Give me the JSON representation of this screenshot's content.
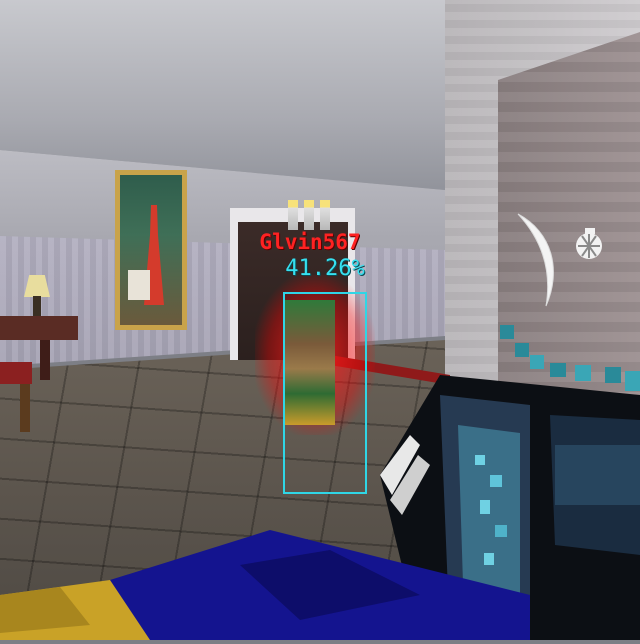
{
  "enemy": {
    "player_name": "Glvin567",
    "detection_confidence": "41.26%"
  },
  "hud": {
    "melee_icon": "melee-slash-icon",
    "grenade_icon": "grenade-icon"
  },
  "colors": {
    "name_tag": "#ff2222",
    "bounding_box": "#2fd6e6",
    "confidence_text": "#36e0f0",
    "enemy_glow": "#ff1e1e"
  }
}
